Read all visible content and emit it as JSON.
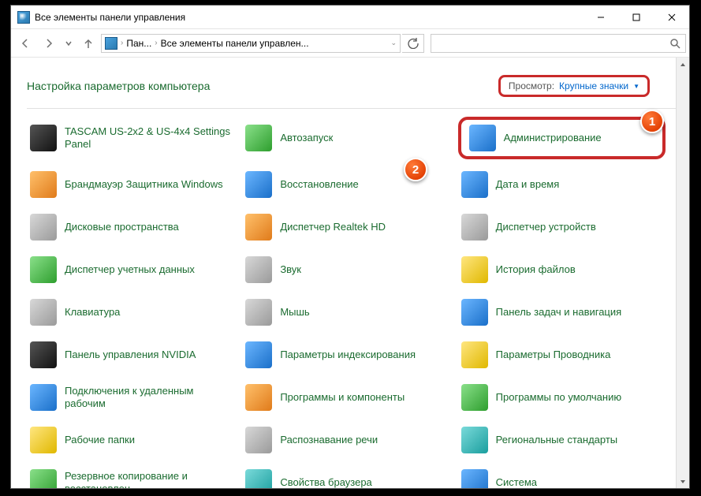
{
  "window": {
    "title": "Все элементы панели управления"
  },
  "breadcrumb": {
    "seg1": "Пан...",
    "seg2": "Все элементы панели управлен..."
  },
  "header": {
    "title": "Настройка параметров компьютера",
    "view_label": "Просмотр:",
    "view_value": "Крупные значки"
  },
  "badges": {
    "b1": "1",
    "b2": "2"
  },
  "items": [
    {
      "label": "TASCAM US-2x2 & US-4x4 Settings Panel",
      "icon": "ic-dark",
      "name": "item-tascam"
    },
    {
      "label": "Автозапуск",
      "icon": "ic-green",
      "name": "item-autoplay"
    },
    {
      "label": "Администрирование",
      "icon": "ic-blue",
      "name": "item-admin-tools",
      "highlight": true
    },
    {
      "label": "Брандмауэр Защитника Windows",
      "icon": "ic-orange",
      "name": "item-firewall"
    },
    {
      "label": "Восстановление",
      "icon": "ic-blue",
      "name": "item-recovery"
    },
    {
      "label": "Дата и время",
      "icon": "ic-blue",
      "name": "item-datetime"
    },
    {
      "label": "Дисковые пространства",
      "icon": "ic-grey",
      "name": "item-storage-spaces"
    },
    {
      "label": "Диспетчер Realtek HD",
      "icon": "ic-orange",
      "name": "item-realtek"
    },
    {
      "label": "Диспетчер устройств",
      "icon": "ic-grey",
      "name": "item-device-manager"
    },
    {
      "label": "Диспетчер учетных данных",
      "icon": "ic-green",
      "name": "item-credential-manager"
    },
    {
      "label": "Звук",
      "icon": "ic-grey",
      "name": "item-sound"
    },
    {
      "label": "История файлов",
      "icon": "ic-yellow",
      "name": "item-file-history"
    },
    {
      "label": "Клавиатура",
      "icon": "ic-grey",
      "name": "item-keyboard"
    },
    {
      "label": "Мышь",
      "icon": "ic-grey",
      "name": "item-mouse"
    },
    {
      "label": "Панель задач и навигация",
      "icon": "ic-blue",
      "name": "item-taskbar"
    },
    {
      "label": "Панель управления NVIDIA",
      "icon": "ic-dark",
      "name": "item-nvidia"
    },
    {
      "label": "Параметры индексирования",
      "icon": "ic-blue",
      "name": "item-indexing"
    },
    {
      "label": "Параметры Проводника",
      "icon": "ic-yellow",
      "name": "item-explorer-options"
    },
    {
      "label": "Подключения к удаленным рабочим",
      "icon": "ic-blue",
      "name": "item-remoteapp"
    },
    {
      "label": "Программы и компоненты",
      "icon": "ic-orange",
      "name": "item-programs"
    },
    {
      "label": "Программы по умолчанию",
      "icon": "ic-green",
      "name": "item-default-programs"
    },
    {
      "label": "Рабочие папки",
      "icon": "ic-yellow",
      "name": "item-work-folders"
    },
    {
      "label": "Распознавание речи",
      "icon": "ic-grey",
      "name": "item-speech"
    },
    {
      "label": "Региональные стандарты",
      "icon": "ic-teal",
      "name": "item-region"
    },
    {
      "label": "Резервное копирование и восстановлен",
      "icon": "ic-green",
      "name": "item-backup"
    },
    {
      "label": "Свойства браузера",
      "icon": "ic-teal",
      "name": "item-internet-options"
    },
    {
      "label": "Система",
      "icon": "ic-blue",
      "name": "item-system"
    }
  ]
}
